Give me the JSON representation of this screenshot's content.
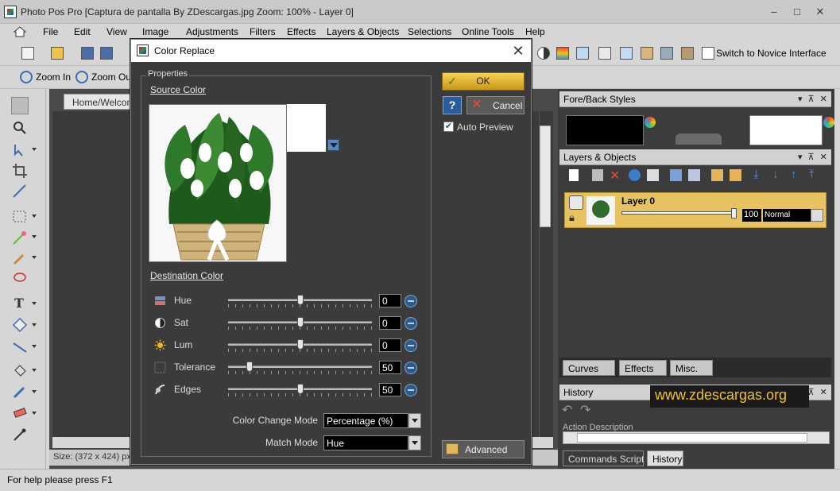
{
  "window": {
    "title": "Photo Pos Pro [Captura de pantalla By ZDescargas.jpg Zoom: 100% - Layer 0]",
    "min": "–",
    "max": "□",
    "close": "✕"
  },
  "menu": [
    "File",
    "Edit",
    "View",
    "Image",
    "Adjustments",
    "Filters",
    "Effects",
    "Layers & Objects",
    "Selections",
    "Online Tools",
    "Help"
  ],
  "toolbar": {
    "switch_label": "Switch to Novice Interface",
    "zoom_in": "Zoom In",
    "zoom_out": "Zoom Out"
  },
  "doc": {
    "tab": "Home/Welcome",
    "status": "Size: (372 x 424) px,"
  },
  "status_bar": "For help please press F1",
  "dialog": {
    "title": "Color Replace",
    "properties_label": "Properties",
    "source_label": "Source Color",
    "destination_label": "Destination Color",
    "rows": [
      {
        "label": "Hue",
        "value": "0",
        "level": 0.5
      },
      {
        "label": "Sat",
        "value": "0",
        "level": 0.5
      },
      {
        "label": "Lum",
        "value": "0",
        "level": 0.5
      },
      {
        "label": "Tolerance",
        "value": "50",
        "level": 0.15
      },
      {
        "label": "Edges",
        "value": "50",
        "level": 0.5
      }
    ],
    "color_change_mode_label": "Color Change Mode",
    "color_change_mode_value": "Percentage (%)",
    "match_mode_label": "Match Mode",
    "match_mode_value": "Hue",
    "ok": "OK",
    "help": "?",
    "cancel": "Cancel",
    "auto_preview": "Auto Preview",
    "advanced": "Advanced"
  },
  "panels": {
    "fore_back": "Fore/Back Styles",
    "layers": "Layers & Objects",
    "layer_name": "Layer 0",
    "layer_opacity": "100",
    "layer_mode": "Normal",
    "tabs": [
      "Curves",
      "Effects",
      "Misc."
    ],
    "history": "History",
    "history_col": "Action Description",
    "bottom_tabs": [
      "Commands Script",
      "History"
    ]
  },
  "watermark": "www.zdescargas.org"
}
